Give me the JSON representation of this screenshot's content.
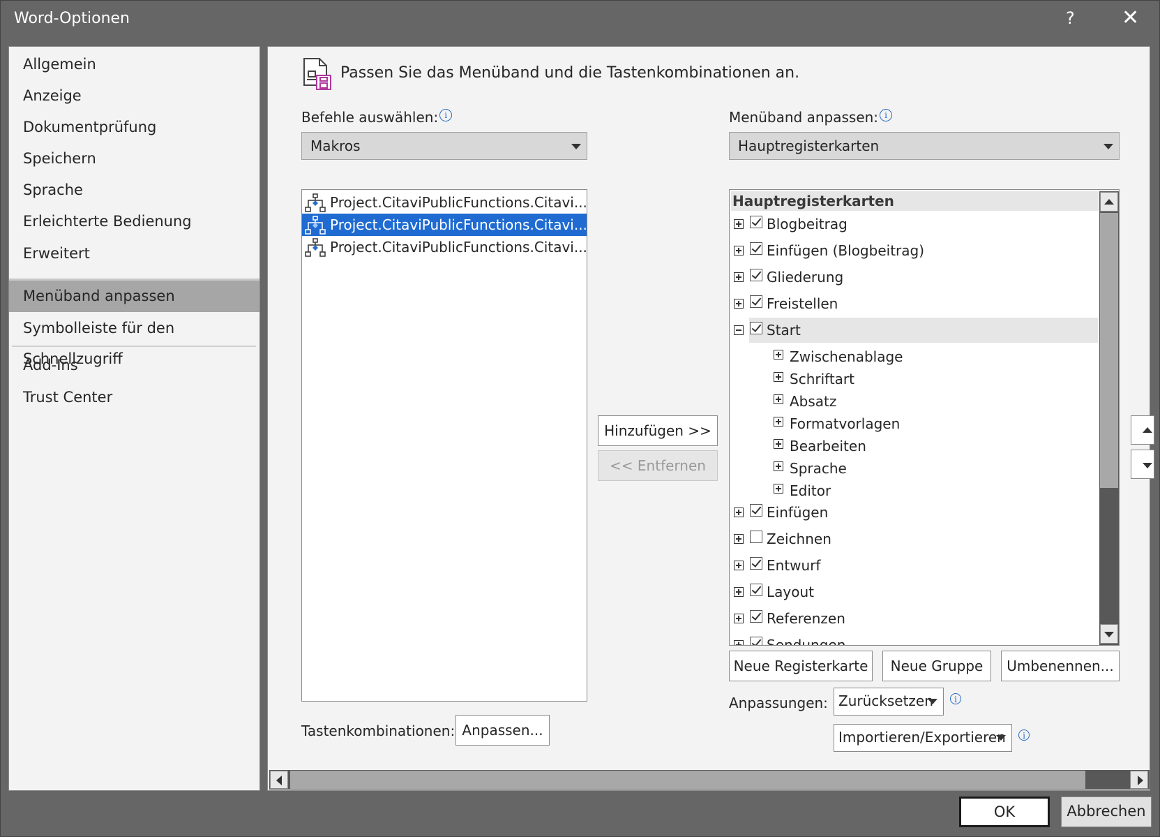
{
  "window": {
    "title": "Word-Optionen",
    "help": "?",
    "close": "✕"
  },
  "sidebar": {
    "items": [
      {
        "label": "Allgemein"
      },
      {
        "label": "Anzeige"
      },
      {
        "label": "Dokumentprüfung"
      },
      {
        "label": "Speichern"
      },
      {
        "label": "Sprache"
      },
      {
        "label": "Erleichterte Bedienung"
      },
      {
        "label": "Erweitert"
      },
      {
        "label": "Menüband anpassen",
        "selected": true
      },
      {
        "label": "Symbolleiste für den Schnellzugriff"
      },
      {
        "label": "Add-Ins"
      },
      {
        "label": "Trust Center"
      }
    ]
  },
  "header": {
    "text": "Passen Sie das Menüband und die Tastenkombinationen an."
  },
  "commands": {
    "label": "Befehle auswählen:",
    "selected": "Makros",
    "list": [
      {
        "label": "Project.CitaviPublicFunctions.Citavi..."
      },
      {
        "label": "Project.CitaviPublicFunctions.Citavi...",
        "selected": true
      },
      {
        "label": "Project.CitaviPublicFunctions.Citavi..."
      }
    ]
  },
  "ribbon": {
    "label": "Menüband anpassen:",
    "selected": "Hauptregisterkarten",
    "tree_header": "Hauptregisterkarten",
    "tabs_top": [
      {
        "label": "Blogbeitrag",
        "checked": true
      },
      {
        "label": "Einfügen (Blogbeitrag)",
        "checked": true
      },
      {
        "label": "Gliederung",
        "checked": true
      },
      {
        "label": "Freistellen",
        "checked": true
      },
      {
        "label": "Start",
        "checked": true,
        "expanded": true
      }
    ],
    "start_groups": [
      {
        "label": "Zwischenablage"
      },
      {
        "label": "Schriftart"
      },
      {
        "label": "Absatz"
      },
      {
        "label": "Formatvorlagen"
      },
      {
        "label": "Bearbeiten"
      },
      {
        "label": "Sprache"
      },
      {
        "label": "Editor"
      }
    ],
    "tabs_bottom": [
      {
        "label": "Einfügen",
        "checked": true
      },
      {
        "label": "Zeichnen",
        "checked": false
      },
      {
        "label": "Entwurf",
        "checked": true
      },
      {
        "label": "Layout",
        "checked": true
      },
      {
        "label": "Referenzen",
        "checked": true
      },
      {
        "label": "Sendungen",
        "checked": true
      }
    ]
  },
  "buttons": {
    "add": "Hinzufügen >>",
    "remove": "<< Entfernen",
    "new_tab": "Neue Registerkarte",
    "new_group": "Neue Gruppe",
    "rename": "Umbenennen...",
    "customize": "Anpassen...",
    "ok": "OK",
    "cancel": "Abbrechen"
  },
  "shortcuts": {
    "label": "Tastenkombinationen:"
  },
  "customizations": {
    "label": "Anpassungen:",
    "reset": "Zurücksetzen",
    "import_export": "Importieren/Exportieren"
  },
  "info_glyph": "i"
}
